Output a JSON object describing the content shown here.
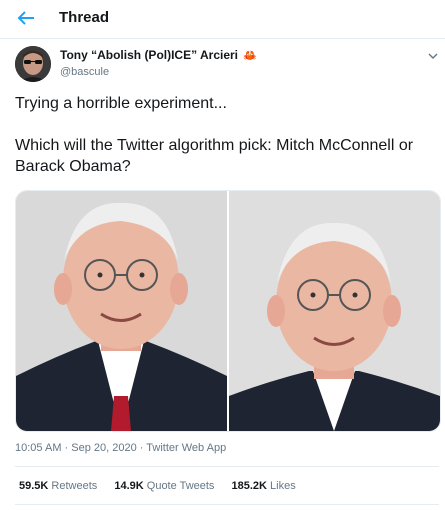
{
  "header": {
    "title": "Thread"
  },
  "author": {
    "name": "Tony “Abolish (Pol)ICE” Arcieri",
    "emoji": "🦀",
    "handle": "@bascule"
  },
  "tweet": {
    "line1": "Trying a horrible experiment...",
    "line2": "Which will the Twitter algorithm pick: Mitch McConnell or Barack Obama?"
  },
  "meta": {
    "time": "10:05 AM",
    "sep1": " · ",
    "date": "Sep 20, 2020",
    "sep2": " · ",
    "source": "Twitter Web App"
  },
  "stats": [
    {
      "count": "59.5K",
      "label": "Retweets"
    },
    {
      "count": "14.9K",
      "label": "Quote Tweets"
    },
    {
      "count": "185.2K",
      "label": "Likes"
    }
  ],
  "colors": {
    "accent": "#1da1f2",
    "secondary_text": "#657786",
    "border": "#e6ecf0"
  }
}
